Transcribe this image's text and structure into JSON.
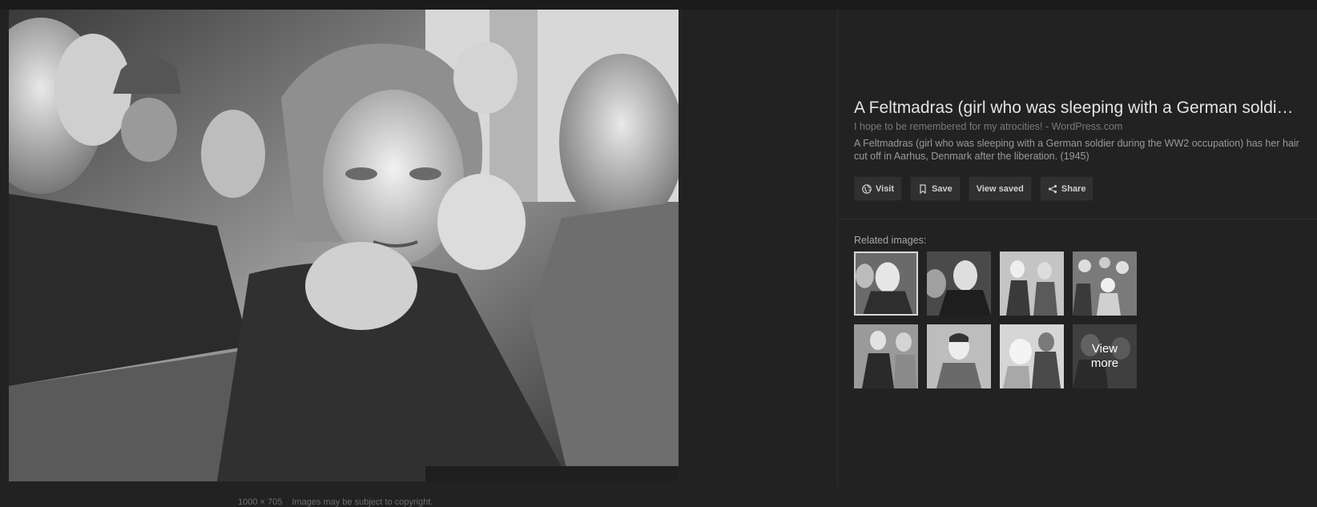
{
  "main": {
    "image_alt": "Black and white photo: a young woman held by several men while her hair is cut",
    "dimensions_text": "1000 × 705",
    "copyright_text": "Images may be subject to copyright."
  },
  "details": {
    "title": "A Feltmadras (girl who was sleeping with a German soldi…",
    "source": "I hope to be remembered for my atrocities! - WordPress.com",
    "description": "A Feltmadras (girl who was sleeping with a German soldier during the WW2 occupation) has her hair cut off in Aarhus, Denmark after the liberation. (1945)"
  },
  "actions": {
    "visit": "Visit",
    "save": "Save",
    "view_saved": "View saved",
    "share": "Share"
  },
  "related": {
    "label": "Related images:",
    "view_more_line1": "View",
    "view_more_line2": "more"
  },
  "colors": {
    "background": "#222222",
    "button_bg": "#303030",
    "title_text": "#e4e4e4"
  },
  "icons": {
    "visit": "globe-icon",
    "save": "bookmark-icon",
    "share": "share-icon"
  }
}
